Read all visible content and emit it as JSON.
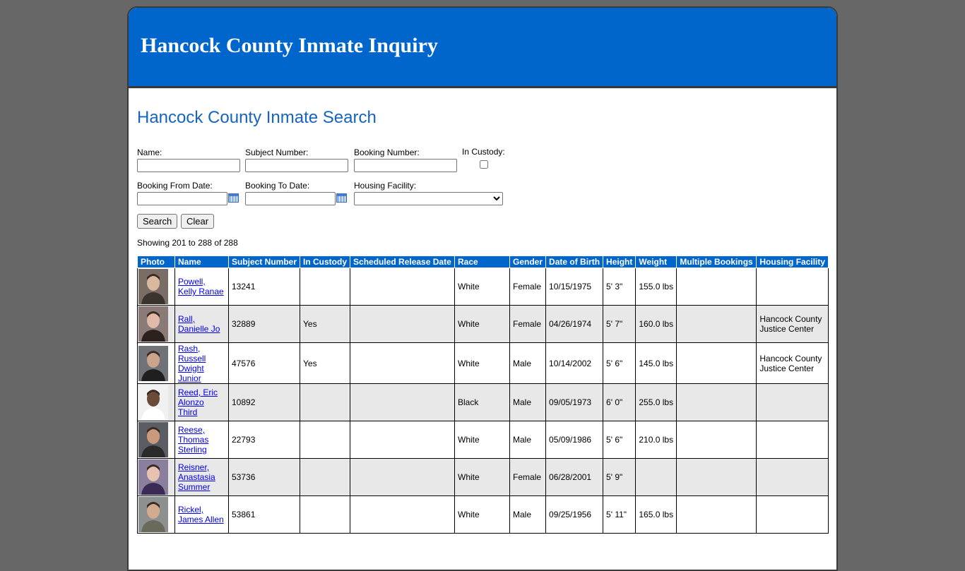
{
  "banner": {
    "title": "Hancock County Inmate Inquiry"
  },
  "search": {
    "title": "Hancock County Inmate Search",
    "name_label": "Name:",
    "name_value": "",
    "subject_label": "Subject Number:",
    "subject_value": "",
    "booking_label": "Booking Number:",
    "booking_value": "",
    "custody_label": "In Custody:",
    "from_label": "Booking From Date:",
    "from_value": "",
    "to_label": "Booking To Date:",
    "to_value": "",
    "facility_label": "Housing Facility:",
    "facility_selected": "",
    "search_button": "Search",
    "clear_button": "Clear"
  },
  "results": {
    "showing": "Showing 201 to 288 of 288",
    "headers": [
      "Photo",
      "Name",
      "Subject Number",
      "In Custody",
      "Scheduled Release Date",
      "Race",
      "Gender",
      "Date of Birth",
      "Height",
      "Weight",
      "Multiple Bookings",
      "Housing Facility"
    ],
    "rows": [
      {
        "name1": "Powell,",
        "name2": "Kelly Ranae",
        "name3": "",
        "name4": "",
        "subject": "13241",
        "custody": "",
        "release": "",
        "race": "White",
        "gender": "Female",
        "dob": "10/15/1975",
        "height": "5' 3\"",
        "weight": "155.0 lbs",
        "multiple": "",
        "facility1": "",
        "facility2": ""
      },
      {
        "name1": "Rall,",
        "name2": "Danielle Jo",
        "name3": "",
        "name4": "",
        "subject": "32889",
        "custody": "Yes",
        "release": "",
        "race": "White",
        "gender": "Female",
        "dob": "04/26/1974",
        "height": "5' 7\"",
        "weight": "160.0 lbs",
        "multiple": "",
        "facility1": "Hancock County",
        "facility2": "Justice Center"
      },
      {
        "name1": "Rash,",
        "name2": "Russell",
        "name3": "Dwight",
        "name4": "Junior",
        "subject": "47576",
        "custody": "Yes",
        "release": "",
        "race": "White",
        "gender": "Male",
        "dob": "10/14/2002",
        "height": "5' 6\"",
        "weight": "145.0 lbs",
        "multiple": "",
        "facility1": "Hancock County",
        "facility2": "Justice Center"
      },
      {
        "name1": "Reed, Eric",
        "name2": "Alonzo Third",
        "name3": "",
        "name4": "",
        "subject": "10892",
        "custody": "",
        "release": "",
        "race": "Black",
        "gender": "Male",
        "dob": "09/05/1973",
        "height": "6' 0\"",
        "weight": "255.0 lbs",
        "multiple": "",
        "facility1": "",
        "facility2": ""
      },
      {
        "name1": "Reese,",
        "name2": "Thomas",
        "name3": "Sterling",
        "name4": "",
        "subject": "22793",
        "custody": "",
        "release": "",
        "race": "White",
        "gender": "Male",
        "dob": "05/09/1986",
        "height": "5' 6\"",
        "weight": "210.0 lbs",
        "multiple": "",
        "facility1": "",
        "facility2": ""
      },
      {
        "name1": "Reisner,",
        "name2": "Anastasia",
        "name3": "Summer",
        "name4": "",
        "subject": "53736",
        "custody": "",
        "release": "",
        "race": "White",
        "gender": "Female",
        "dob": "06/28/2001",
        "height": "5' 9\"",
        "weight": "",
        "multiple": "",
        "facility1": "",
        "facility2": ""
      },
      {
        "name1": "Rickel,",
        "name2": "James Allen",
        "name3": "",
        "name4": "",
        "subject": "53861",
        "custody": "",
        "release": "",
        "race": "White",
        "gender": "Male",
        "dob": "09/25/1956",
        "height": "5' 11\"",
        "weight": "165.0 lbs",
        "multiple": "",
        "facility1": "",
        "facility2": ""
      }
    ]
  }
}
